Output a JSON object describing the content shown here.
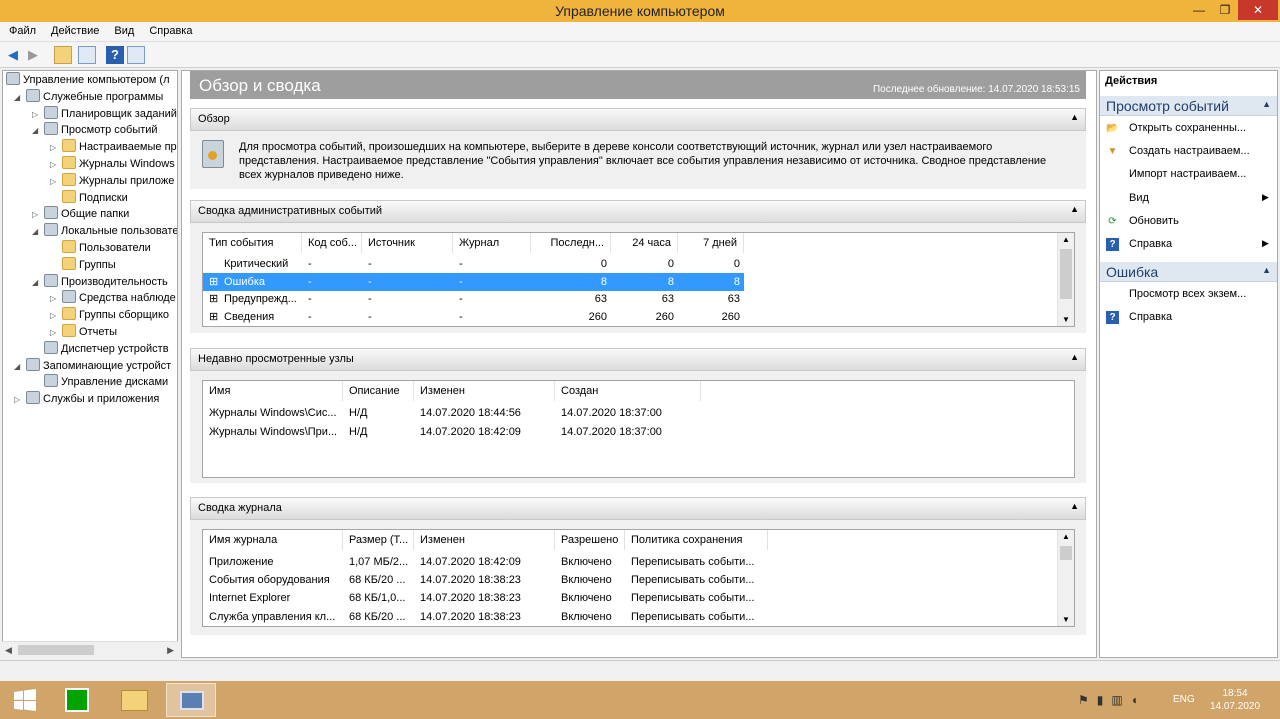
{
  "window": {
    "title": "Управление компьютером",
    "min_icon": "minimize-icon",
    "max_icon": "maximize-icon",
    "close_icon": "close-icon",
    "min": "—",
    "max": "❐",
    "close": "✕"
  },
  "menu": [
    "Файл",
    "Действие",
    "Вид",
    "Справка"
  ],
  "tree": [
    {
      "label": "Управление компьютером (л",
      "level": 0,
      "exp": "",
      "icon": "computer-icon"
    },
    {
      "label": "Служебные программы",
      "level": 1,
      "exp": "◢",
      "icon": "tools-icon"
    },
    {
      "label": "Планировщик заданий",
      "level": 2,
      "exp": "▷",
      "icon": "clock-icon"
    },
    {
      "label": "Просмотр событий",
      "level": 2,
      "exp": "◢",
      "icon": "event-viewer-icon"
    },
    {
      "label": "Настраиваемые пр",
      "level": 3,
      "exp": "▷",
      "icon": "folder-icon"
    },
    {
      "label": "Журналы Windows",
      "level": 3,
      "exp": "▷",
      "icon": "folder-icon"
    },
    {
      "label": "Журналы приложе",
      "level": 3,
      "exp": "▷",
      "icon": "folder-icon"
    },
    {
      "label": "Подписки",
      "level": 3,
      "exp": "",
      "icon": "folder-icon"
    },
    {
      "label": "Общие папки",
      "level": 2,
      "exp": "▷",
      "icon": "shared-folder-icon"
    },
    {
      "label": "Локальные пользовате",
      "level": 2,
      "exp": "◢",
      "icon": "users-icon"
    },
    {
      "label": "Пользователи",
      "level": 3,
      "exp": "",
      "icon": "folder-icon"
    },
    {
      "label": "Группы",
      "level": 3,
      "exp": "",
      "icon": "folder-icon"
    },
    {
      "label": "Производительность",
      "level": 2,
      "exp": "◢",
      "icon": "performance-icon"
    },
    {
      "label": "Средства наблюде",
      "level": 3,
      "exp": "▷",
      "icon": "monitor-icon"
    },
    {
      "label": "Группы сборщико",
      "level": 3,
      "exp": "▷",
      "icon": "folder-icon"
    },
    {
      "label": "Отчеты",
      "level": 3,
      "exp": "▷",
      "icon": "folder-icon"
    },
    {
      "label": "Диспетчер устройств",
      "level": 2,
      "exp": "",
      "icon": "device-manager-icon"
    },
    {
      "label": "Запоминающие устройст",
      "level": 1,
      "exp": "◢",
      "icon": "storage-icon"
    },
    {
      "label": "Управление дисками",
      "level": 2,
      "exp": "",
      "icon": "disk-icon"
    },
    {
      "label": "Службы и приложения",
      "level": 1,
      "exp": "▷",
      "icon": "services-icon"
    }
  ],
  "overview": {
    "title": "Обзор и сводка",
    "updated": "Последнее обновление: 14.07.2020 18:53:15"
  },
  "panel1": {
    "title": "Обзор",
    "text": "Для просмотра событий, произошедших на компьютере, выберите в дереве консоли соответствующий источник, журнал или узел настраиваемого представления. Настраиваемое представление \"События управления\" включает все события управления независимо от источника. Сводное представление всех журналов приведено ниже."
  },
  "panel2": {
    "title": "Сводка административных событий",
    "cols": [
      "Тип события",
      "Код соб...",
      "Источник",
      "Журнал",
      "Последн...",
      "24 часа",
      "7 дней"
    ],
    "rows": [
      {
        "plus": "",
        "type": "Критический",
        "code": "-",
        "src": "-",
        "log": "-",
        "last": "0",
        "d24": "0",
        "d7": "0"
      },
      {
        "plus": "⊞",
        "type": "Ошибка",
        "code": "-",
        "src": "-",
        "log": "-",
        "last": "8",
        "d24": "8",
        "d7": "8"
      },
      {
        "plus": "⊞",
        "type": "Предупрежд...",
        "code": "-",
        "src": "-",
        "log": "-",
        "last": "63",
        "d24": "63",
        "d7": "63"
      },
      {
        "plus": "⊞",
        "type": "Сведения",
        "code": "-",
        "src": "-",
        "log": "-",
        "last": "260",
        "d24": "260",
        "d7": "260"
      }
    ]
  },
  "panel3": {
    "title": "Недавно просмотренные узлы",
    "cols": [
      "Имя",
      "Описание",
      "Изменен",
      "Создан"
    ],
    "rows": [
      {
        "name": "Журналы Windows\\Сис...",
        "desc": "Н/Д",
        "mod": "14.07.2020 18:44:56",
        "created": "14.07.2020 18:37:00"
      },
      {
        "name": "Журналы Windows\\При...",
        "desc": "Н/Д",
        "mod": "14.07.2020 18:42:09",
        "created": "14.07.2020 18:37:00"
      }
    ]
  },
  "panel4": {
    "title": "Сводка журнала",
    "cols": [
      "Имя журнала",
      "Размер (Т...",
      "Изменен",
      "Разрешено",
      "Политика сохранения"
    ],
    "rows": [
      {
        "name": "Приложение",
        "size": "1,07 МБ/2...",
        "mod": "14.07.2020 18:42:09",
        "en": "Включено",
        "pol": "Переписывать событи..."
      },
      {
        "name": "События оборудования",
        "size": "68 КБ/20 ...",
        "mod": "14.07.2020 18:38:23",
        "en": "Включено",
        "pol": "Переписывать событи..."
      },
      {
        "name": "Internet Explorer",
        "size": "68 КБ/1,0...",
        "mod": "14.07.2020 18:38:23",
        "en": "Включено",
        "pol": "Переписывать событи..."
      },
      {
        "name": "Служба управления кл...",
        "size": "68 КБ/20 ...",
        "mod": "14.07.2020 18:38:23",
        "en": "Включено",
        "pol": "Переписывать событи..."
      }
    ]
  },
  "actions": {
    "title": "Действия",
    "sec1": "Просмотр событий",
    "items1": [
      {
        "label": "Открыть сохраненны...",
        "icon": "open-icon",
        "g": "📂",
        "arrow": ""
      },
      {
        "label": "Создать настраиваем...",
        "icon": "filter-icon",
        "g": "▼",
        "arrow": ""
      },
      {
        "label": "Импорт настраиваем...",
        "icon": "",
        "g": "",
        "arrow": ""
      },
      {
        "label": "Вид",
        "icon": "",
        "g": "",
        "arrow": "▶"
      },
      {
        "label": "Обновить",
        "icon": "refresh-icon",
        "g": "⟳",
        "arrow": ""
      },
      {
        "label": "Справка",
        "icon": "help-icon",
        "g": "?",
        "arrow": "▶"
      }
    ],
    "sec2": "Ошибка",
    "items2": [
      {
        "label": "Просмотр всех экзем...",
        "icon": "",
        "g": "",
        "arrow": ""
      },
      {
        "label": "Справка",
        "icon": "help-icon",
        "g": "?",
        "arrow": ""
      }
    ]
  },
  "tray": {
    "lang": "ENG",
    "time": "18:54",
    "date": "14.07.2020"
  }
}
